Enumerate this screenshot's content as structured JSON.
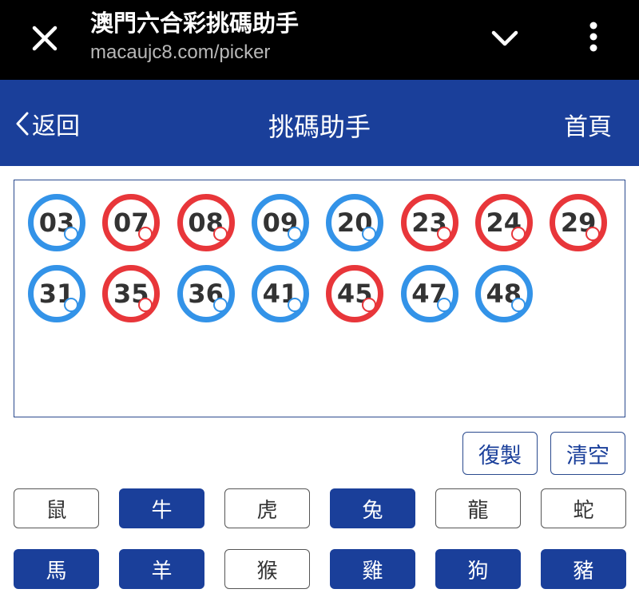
{
  "browser": {
    "title": "澳門六合彩挑碼助手",
    "url": "macaujc8.com/picker"
  },
  "header": {
    "back_label": "返回",
    "title": "挑碼助手",
    "home_label": "首頁",
    "background_color": "#1a3f9a"
  },
  "numbers": [
    {
      "value": "03",
      "color": "blue"
    },
    {
      "value": "07",
      "color": "red"
    },
    {
      "value": "08",
      "color": "red"
    },
    {
      "value": "09",
      "color": "blue"
    },
    {
      "value": "20",
      "color": "blue"
    },
    {
      "value": "23",
      "color": "red"
    },
    {
      "value": "24",
      "color": "red"
    },
    {
      "value": "29",
      "color": "red"
    },
    {
      "value": "31",
      "color": "blue"
    },
    {
      "value": "35",
      "color": "red"
    },
    {
      "value": "36",
      "color": "blue"
    },
    {
      "value": "41",
      "color": "blue"
    },
    {
      "value": "45",
      "color": "red"
    },
    {
      "value": "47",
      "color": "blue"
    },
    {
      "value": "48",
      "color": "blue"
    }
  ],
  "ball_colors": {
    "blue": "#3393e8",
    "red": "#e8363a"
  },
  "actions": {
    "copy_label": "復製",
    "clear_label": "清空"
  },
  "zodiac": [
    {
      "label": "鼠",
      "selected": false
    },
    {
      "label": "牛",
      "selected": true
    },
    {
      "label": "虎",
      "selected": false
    },
    {
      "label": "兔",
      "selected": true
    },
    {
      "label": "龍",
      "selected": false
    },
    {
      "label": "蛇",
      "selected": false
    },
    {
      "label": "馬",
      "selected": true
    },
    {
      "label": "羊",
      "selected": true
    },
    {
      "label": "猴",
      "selected": false
    },
    {
      "label": "雞",
      "selected": true
    },
    {
      "label": "狗",
      "selected": true
    },
    {
      "label": "豬",
      "selected": true
    }
  ]
}
